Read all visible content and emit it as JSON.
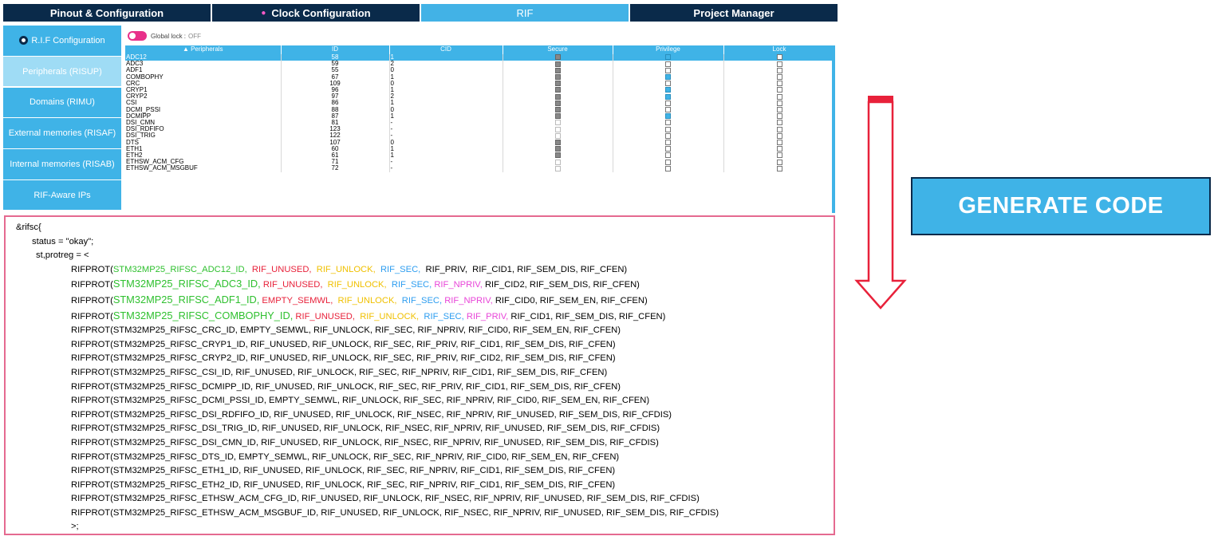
{
  "tabs": [
    {
      "label": "Pinout & Configuration",
      "marker": ""
    },
    {
      "label": "Clock Configuration",
      "marker": "●"
    },
    {
      "label": "RIF",
      "marker": ""
    },
    {
      "label": "Project Manager",
      "marker": ""
    }
  ],
  "sidebar": {
    "items": [
      {
        "label": "R.I.F Configuration"
      },
      {
        "label": "Peripherals (RISUP)"
      },
      {
        "label": "Domains (RIMU)"
      },
      {
        "label": "External memories (RISAF)"
      },
      {
        "label": "Internal memories (RISAB)"
      },
      {
        "label": "RIF-Aware IPs"
      }
    ]
  },
  "global_lock": {
    "label": "Global lock :",
    "state": "OFF"
  },
  "peripheral_table": {
    "columns": [
      "Peripherals",
      "ID",
      "CID",
      "Secure",
      "Privilege",
      "Lock"
    ],
    "rows": [
      {
        "name": "ADC12",
        "id": "58",
        "cid": "1",
        "secure": "gray",
        "privilege": "blue",
        "lock": "white"
      },
      {
        "name": "ADC3",
        "id": "59",
        "cid": "2",
        "secure": "gray",
        "privilege": "white",
        "lock": "white"
      },
      {
        "name": "ADF1",
        "id": "55",
        "cid": "0",
        "secure": "gray",
        "privilege": "white",
        "lock": "white"
      },
      {
        "name": "COMBOPHY",
        "id": "67",
        "cid": "1",
        "secure": "gray",
        "privilege": "blue",
        "lock": "white"
      },
      {
        "name": "CRC",
        "id": "109",
        "cid": "0",
        "secure": "gray",
        "privilege": "white",
        "lock": "white"
      },
      {
        "name": "CRYP1",
        "id": "96",
        "cid": "1",
        "secure": "gray",
        "privilege": "blue",
        "lock": "white"
      },
      {
        "name": "CRYP2",
        "id": "97",
        "cid": "2",
        "secure": "gray",
        "privilege": "blue",
        "lock": "white"
      },
      {
        "name": "CSI",
        "id": "86",
        "cid": "1",
        "secure": "gray",
        "privilege": "white",
        "lock": "white"
      },
      {
        "name": "DCMI_PSSI",
        "id": "88",
        "cid": "0",
        "secure": "gray",
        "privilege": "white",
        "lock": "white"
      },
      {
        "name": "DCMIPP",
        "id": "87",
        "cid": "1",
        "secure": "gray",
        "privilege": "blue",
        "lock": "white"
      },
      {
        "name": "DSI_CMN",
        "id": "81",
        "cid": "-",
        "secure": "light",
        "privilege": "white",
        "lock": "white"
      },
      {
        "name": "DSI_RDFIFO",
        "id": "123",
        "cid": "-",
        "secure": "light",
        "privilege": "white",
        "lock": "white"
      },
      {
        "name": "DSI_TRIG",
        "id": "122",
        "cid": "-",
        "secure": "light",
        "privilege": "white",
        "lock": "white"
      },
      {
        "name": "DTS",
        "id": "107",
        "cid": "0",
        "secure": "gray",
        "privilege": "white",
        "lock": "white"
      },
      {
        "name": "ETH1",
        "id": "60",
        "cid": "1",
        "secure": "gray",
        "privilege": "white",
        "lock": "white"
      },
      {
        "name": "ETH2",
        "id": "61",
        "cid": "1",
        "secure": "gray",
        "privilege": "white",
        "lock": "white"
      },
      {
        "name": "ETHSW_ACM_CFG",
        "id": "71",
        "cid": "-",
        "secure": "light",
        "privilege": "white",
        "lock": "white"
      },
      {
        "name": "ETHSW_ACM_MSGBUF",
        "id": "72",
        "cid": "-",
        "secure": "light",
        "privilege": "white",
        "lock": "white"
      }
    ]
  },
  "code": {
    "open": "&rifsc{",
    "status": "status = \"okay\";",
    "protreg": "st,protreg = <",
    "colored_lines": [
      {
        "id": "STM32MP25_RIFSC_ADC12_ID,",
        "cid_unused": "RIF_UNUSED,",
        "lock": "RIF_UNLOCK,",
        "sec": "RIF_SEC,",
        "priv": "RIF_PRIV,",
        "rest": "RIF_CID1,  RIF_SEM_DIS,  RIF_CFEN)"
      },
      {
        "id": "STM32MP25_RIFSC_ADC3_ID,",
        "cid_unused": "RIF_UNUSED,",
        "lock": "RIF_UNLOCK,",
        "sec": "RIF_SEC,",
        "priv": "RIF_NPRIV,",
        "rest": "RIF_CID2,  RIF_SEM_DIS,  RIF_CFEN)"
      },
      {
        "id": "STM32MP25_RIFSC_ADF1_ID,",
        "cid_unused": "EMPTY_SEMWL,",
        "lock": "RIF_UNLOCK,",
        "sec": "RIF_SEC,",
        "priv": "RIF_NPRIV,",
        "rest": "RIF_CID0,  RIF_SEM_EN,  RIF_CFEN)"
      },
      {
        "id": "STM32MP25_RIFSC_COMBOPHY_ID,",
        "cid_unused": "RIF_UNUSED,",
        "lock": "RIF_UNLOCK,",
        "sec": "RIF_SEC,",
        "priv": "RIF_PRIV,",
        "rest": "RIF_CID1,  RIF_SEM_DIS,  RIF_CFEN)"
      }
    ],
    "plain_lines": [
      "RIFPROT(STM32MP25_RIFSC_CRC_ID,  EMPTY_SEMWL,  RIF_UNLOCK,  RIF_SEC,  RIF_NPRIV,  RIF_CID0,  RIF_SEM_EN,  RIF_CFEN)",
      "RIFPROT(STM32MP25_RIFSC_CRYP1_ID,  RIF_UNUSED,  RIF_UNLOCK,  RIF_SEC,  RIF_PRIV,  RIF_CID1,  RIF_SEM_DIS,  RIF_CFEN)",
      "RIFPROT(STM32MP25_RIFSC_CRYP2_ID,  RIF_UNUSED,  RIF_UNLOCK,  RIF_SEC,  RIF_PRIV,  RIF_CID2,  RIF_SEM_DIS,  RIF_CFEN)",
      "RIFPROT(STM32MP25_RIFSC_CSI_ID,  RIF_UNUSED,  RIF_UNLOCK,  RIF_SEC,  RIF_NPRIV,  RIF_CID1,  RIF_SEM_DIS,  RIF_CFEN)",
      "RIFPROT(STM32MP25_RIFSC_DCMIPP_ID,  RIF_UNUSED,  RIF_UNLOCK,  RIF_SEC,  RIF_PRIV,  RIF_CID1,  RIF_SEM_DIS,  RIF_CFEN)",
      "RIFPROT(STM32MP25_RIFSC_DCMI_PSSI_ID,  EMPTY_SEMWL,  RIF_UNLOCK,  RIF_SEC,  RIF_NPRIV,  RIF_CID0,  RIF_SEM_EN,  RIF_CFEN)",
      "RIFPROT(STM32MP25_RIFSC_DSI_RDFIFO_ID,  RIF_UNUSED,  RIF_UNLOCK,  RIF_NSEC,  RIF_NPRIV,  RIF_UNUSED,  RIF_SEM_DIS,  RIF_CFDIS)",
      "RIFPROT(STM32MP25_RIFSC_DSI_TRIG_ID,  RIF_UNUSED,  RIF_UNLOCK,  RIF_NSEC,  RIF_NPRIV,  RIF_UNUSED,  RIF_SEM_DIS,  RIF_CFDIS)",
      "RIFPROT(STM32MP25_RIFSC_DSI_CMN_ID,  RIF_UNUSED,  RIF_UNLOCK,  RIF_NSEC,  RIF_NPRIV,  RIF_UNUSED,  RIF_SEM_DIS,  RIF_CFDIS)",
      "RIFPROT(STM32MP25_RIFSC_DTS_ID,  EMPTY_SEMWL,  RIF_UNLOCK,  RIF_SEC,  RIF_NPRIV,  RIF_CID0,  RIF_SEM_EN,  RIF_CFEN)",
      "RIFPROT(STM32MP25_RIFSC_ETH1_ID,  RIF_UNUSED,  RIF_UNLOCK,  RIF_SEC,  RIF_NPRIV,  RIF_CID1,  RIF_SEM_DIS,  RIF_CFEN)",
      "RIFPROT(STM32MP25_RIFSC_ETH2_ID,  RIF_UNUSED,  RIF_UNLOCK,  RIF_SEC,  RIF_NPRIV,  RIF_CID1,  RIF_SEM_DIS,  RIF_CFEN)",
      "RIFPROT(STM32MP25_RIFSC_ETHSW_ACM_CFG_ID,  RIF_UNUSED,  RIF_UNLOCK,  RIF_NSEC,  RIF_NPRIV,  RIF_UNUSED,  RIF_SEM_DIS,  RIF_CFDIS)",
      "RIFPROT(STM32MP25_RIFSC_ETHSW_ACM_MSGBUF_ID,  RIF_UNUSED,  RIF_UNLOCK,  RIF_NSEC,  RIF_NPRIV,  RIF_UNUSED,  RIF_SEM_DIS,  RIF_CFDIS)"
    ],
    "prefix": "RIFPROT(",
    "close": ">;"
  },
  "generate_button": {
    "label": "GENERATE CODE"
  },
  "colors": {
    "accent": "#3fb3e7",
    "tab_dark": "#0a2a4a",
    "code_border": "#e56a90",
    "arrow": "#e8213a"
  }
}
